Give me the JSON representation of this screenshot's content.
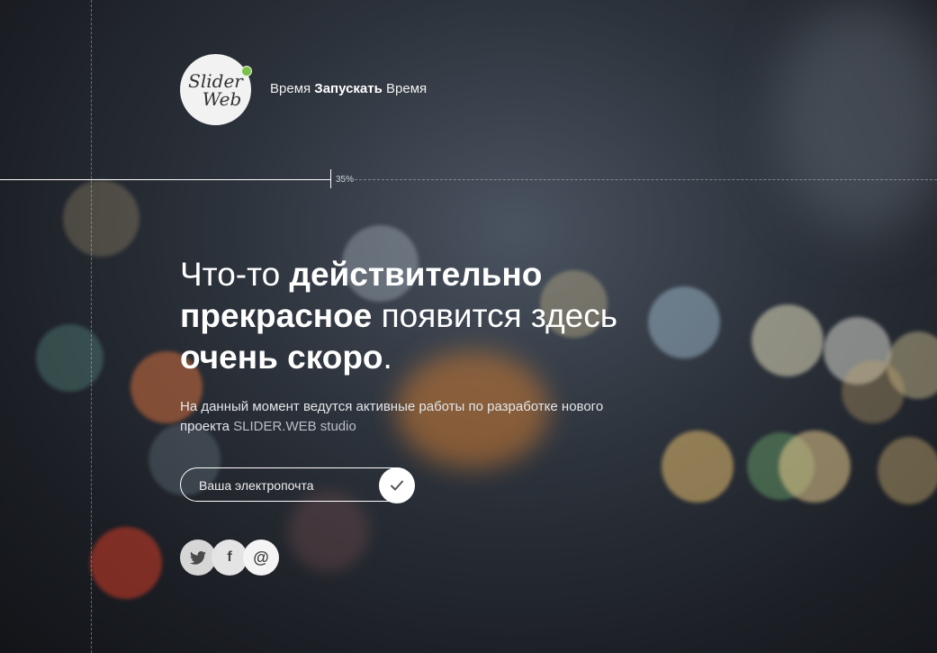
{
  "logo": {
    "line1": "Slider",
    "line2": "Web"
  },
  "tagline": {
    "word1": "Время",
    "word2": "Запускать",
    "word3": "Время"
  },
  "progress": {
    "value": 0.35,
    "label": "35%"
  },
  "headline": {
    "part1": "Что-то ",
    "part2": "действительно",
    "part3": "прекрасное",
    "part4": " появится здесь",
    "part5": "очень скоро",
    "part6": "."
  },
  "description": {
    "text": "На данный момент ведутся активные работы по разработке нового проекта ",
    "studio": "SLIDER.WEB studio"
  },
  "subscribe": {
    "placeholder": "Ваша электропочта",
    "submit_icon": "checkmark-icon"
  },
  "social": [
    {
      "name": "twitter",
      "icon": "twitter-icon"
    },
    {
      "name": "facebook",
      "icon": "facebook-icon",
      "glyph": "f"
    },
    {
      "name": "email",
      "icon": "at-icon",
      "glyph": "@"
    }
  ],
  "colors": {
    "accent": "#7cc04b",
    "background": "#2c323b"
  }
}
